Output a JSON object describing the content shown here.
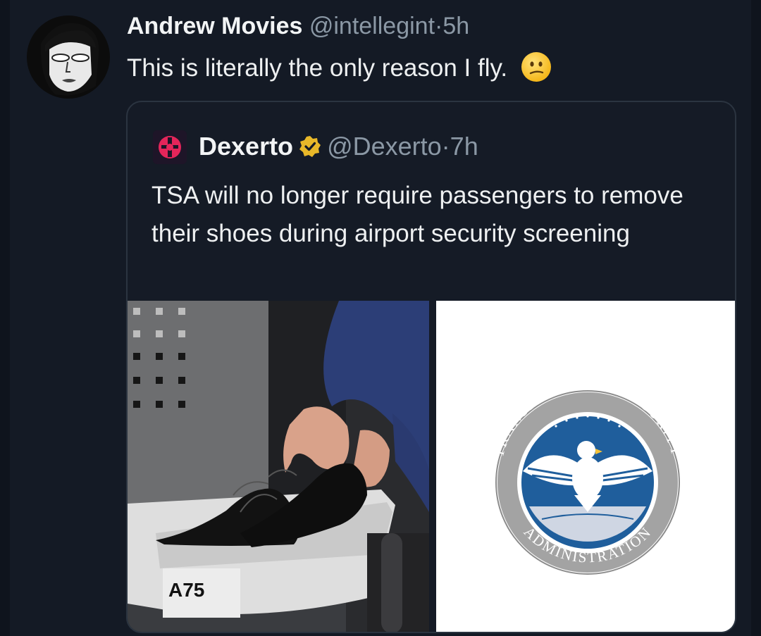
{
  "tweet": {
    "author_name": "Andrew Movies",
    "author_handle": "@intellegint",
    "separator": "·",
    "time": "5h",
    "text": "This is literally the only reason I fly.",
    "emoji_icon": "confused-face-icon"
  },
  "quoted_tweet": {
    "author_name": "Dexerto",
    "verified_icon": "gold-verified-badge-icon",
    "author_handle": "@Dexerto",
    "separator": "·",
    "time": "7h",
    "text": "TSA will no longer require passengers to remove their shoes during airport security screening",
    "media": [
      {
        "description": "shoe-in-security-bin-photo",
        "bin_label": "A75"
      },
      {
        "description": "tsa-seal-logo",
        "seal_top_text": "TRANSPORTATION SECURITY",
        "seal_bottom_text": "ADMINISTRATION"
      }
    ]
  },
  "colors": {
    "background": "#141a25",
    "text_primary": "#e7e9ea",
    "text_secondary": "#8b98a5",
    "card_border": "#2b3440",
    "verified_gold": "#e8b829",
    "seal_blue": "#1f5e9c"
  }
}
